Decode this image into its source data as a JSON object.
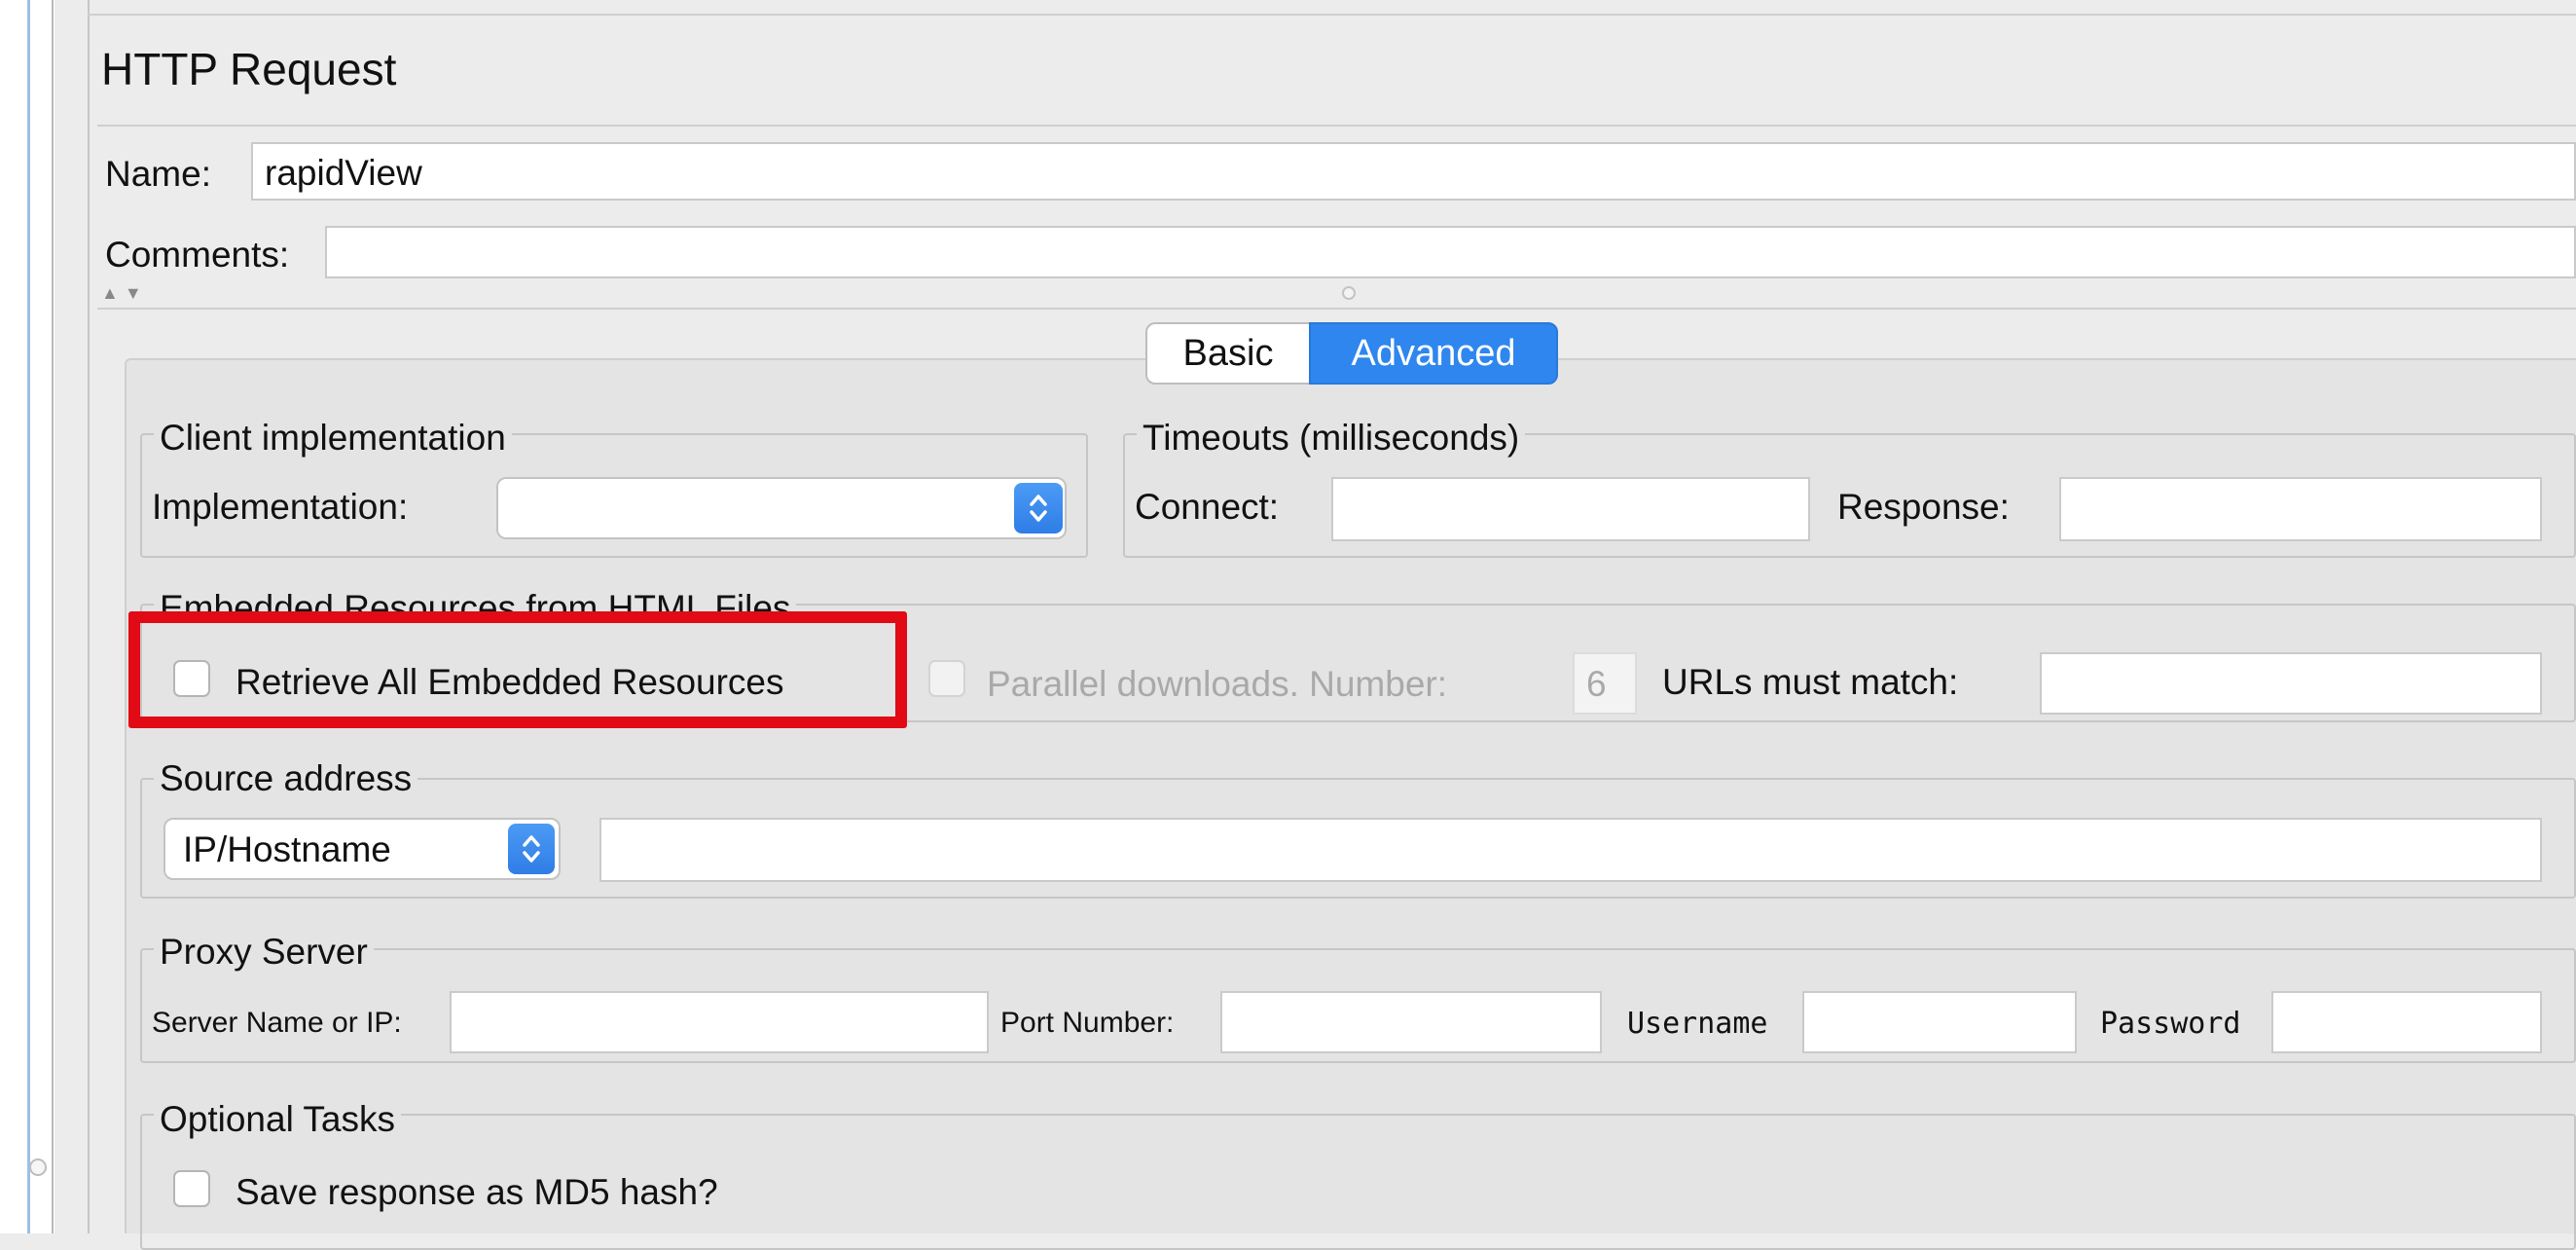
{
  "window": {
    "title": "HTTP Request"
  },
  "name_field": {
    "label": "Name:",
    "value": "rapidView"
  },
  "comments_field": {
    "label": "Comments:",
    "value": ""
  },
  "splitter": {
    "arrows": "▲▼"
  },
  "tabs": [
    {
      "label": "Basic",
      "selected": false
    },
    {
      "label": "Advanced",
      "selected": true
    }
  ],
  "client_impl": {
    "legend": "Client implementation",
    "impl_label": "Implementation:",
    "impl_value": ""
  },
  "timeouts": {
    "legend": "Timeouts (milliseconds)",
    "connect_label": "Connect:",
    "connect_value": "",
    "response_label": "Response:",
    "response_value": ""
  },
  "embedded": {
    "legend": "Embedded Resources from HTML Files",
    "retrieve_label": "Retrieve All Embedded Resources",
    "retrieve_checked": false,
    "parallel_label": "Parallel downloads. Number:",
    "parallel_value": "6",
    "urls_label": "URLs must match:",
    "urls_value": ""
  },
  "source_address": {
    "legend": "Source address",
    "type_value": "IP/Hostname",
    "address_value": ""
  },
  "proxy": {
    "legend": "Proxy Server",
    "server_label": "Server Name or IP:",
    "port_label": "Port Number:",
    "username_label": "Username",
    "password_label": "Password",
    "server_value": "",
    "port_value": "",
    "username_value": "",
    "password_value": ""
  },
  "optional": {
    "legend": "Optional Tasks",
    "md5_label": "Save response as MD5 hash?",
    "md5_checked": false
  },
  "colors": {
    "accent": "#2f86ee",
    "highlight": "#e10a15"
  }
}
